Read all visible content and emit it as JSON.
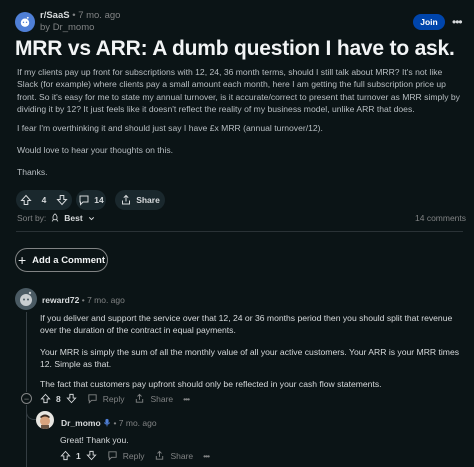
{
  "post": {
    "subreddit": "r/SaaS",
    "age": "7 mo. ago",
    "author_prefix": "by",
    "author": "Dr_momo",
    "join_label": "Join",
    "more_label": "•••",
    "title": "MRR vs ARR: A dumb question I have to ask.",
    "paragraphs": [
      "If my clients pay up front for subscriptions with 12, 24, 36 month terms, should I still talk about MRR? It's not like Slack (for example) where clients pay a small amount each month, here I am getting the full subscription price up front. So it's easy for me to state my annual turnover, is it accurate/correct to present that turnover as MRR simply by dividing it by 12? It just feels like it doesn't reflect the reality of my business model, unlike ARR that does.",
      "I fear I'm overthinking it and should just say I have £x MRR (annual turnover/12).",
      "Would love to hear your thoughts on this.",
      "Thanks."
    ],
    "votes": "4",
    "comments": "14",
    "share_label": "Share"
  },
  "sort": {
    "label": "Sort by:",
    "value": "Best",
    "count_label": "14 comments"
  },
  "add_comment_label": "Add a Comment",
  "comments": [
    {
      "author": "reward72",
      "age": "7 mo. ago",
      "paragraphs": [
        "If you deliver and support the service over that 12, 24 or 36 months period then you should split that revenue over the duration of the contract in equal payments.",
        "Your MRR is simply the sum of all the monthly value of all your active customers. Your ARR is your MRR times 12. Simple as that.",
        "The fact that customers pay upfront should only be reflected in your cash flow statements."
      ],
      "votes": "8",
      "reply_label": "Reply",
      "share_label": "Share",
      "more_label": "•••",
      "collapse_label": "−"
    },
    {
      "author": "Dr_momo",
      "age": "7 mo. ago",
      "text": "Great! Thank you.",
      "votes": "1",
      "reply_label": "Reply",
      "share_label": "Share",
      "more_label": "•••"
    }
  ],
  "colors": {
    "background": "#0b1416",
    "join_button": "#0045ac",
    "op_badge": "#4f7fd6",
    "muted_text": "#818384"
  }
}
